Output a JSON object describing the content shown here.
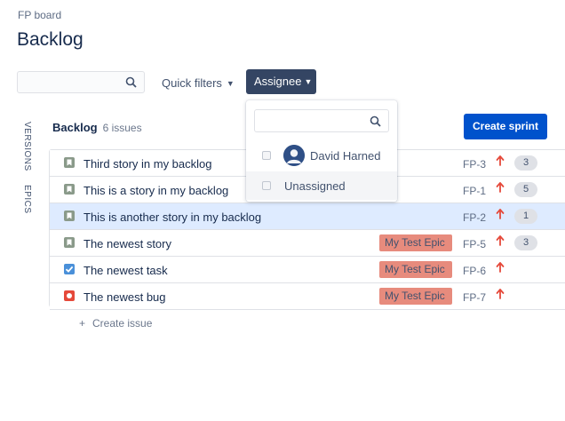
{
  "breadcrumb": "FP board",
  "page_title": "Backlog",
  "search": {
    "value": "",
    "icon": "search-icon"
  },
  "quick_filters": {
    "label": "Quick filters",
    "icon": "chevron-down-icon"
  },
  "assignee_filter": {
    "label": "Assignee",
    "icon": "chevron-down-icon",
    "color": "#344563"
  },
  "side_tabs": [
    "VERSIONS",
    "EPICS"
  ],
  "backlog": {
    "label": "Backlog",
    "count_label": "6 issues",
    "create_sprint_label": "Create sprint",
    "create_issue_label": "Create issue",
    "issues": [
      {
        "type": "story",
        "summary": "Third story in my backlog",
        "epic": "",
        "key": "FP-3",
        "priority": "high",
        "estimate": "3"
      },
      {
        "type": "story",
        "summary": "This is a story in my backlog",
        "epic": "",
        "key": "FP-1",
        "priority": "high",
        "estimate": "5"
      },
      {
        "type": "story",
        "summary": "This is another story in my backlog",
        "epic": "",
        "key": "FP-2",
        "priority": "high",
        "estimate": "1",
        "selected": true
      },
      {
        "type": "story",
        "summary": "The newest story",
        "epic": "My Test Epic",
        "key": "FP-5",
        "priority": "high",
        "estimate": "3"
      },
      {
        "type": "task",
        "summary": "The newest task",
        "epic": "My Test Epic",
        "key": "FP-6",
        "priority": "high",
        "estimate": ""
      },
      {
        "type": "bug",
        "summary": "The newest bug",
        "epic": "My Test Epic",
        "key": "FP-7",
        "priority": "high",
        "estimate": ""
      }
    ]
  },
  "assignee_dropdown": {
    "search_value": "",
    "options": [
      {
        "name": "David Harned",
        "checked": false,
        "avatar": "avatar-icon"
      },
      {
        "name": "Unassigned",
        "checked": false
      }
    ]
  },
  "colors": {
    "primary": "#0052cc",
    "epic": "#e78b7d",
    "selected_row": "#deebff",
    "priority": "#e5493a"
  }
}
